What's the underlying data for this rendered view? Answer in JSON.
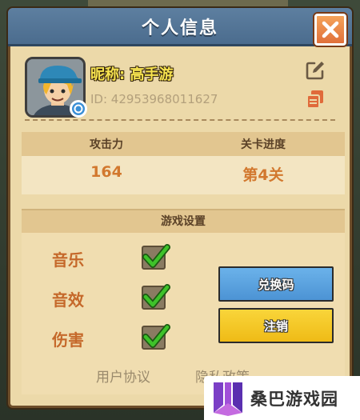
{
  "dialog": {
    "title": "个人信息",
    "close_icon": "close-icon"
  },
  "profile": {
    "nickname": "昵称: 高手游",
    "player_id": "ID: 42953968011627",
    "avatar": "avatar",
    "edit_icon": "edit-icon",
    "copy_icon": "copy-icon"
  },
  "stats": {
    "attack_label": "攻击力",
    "attack_value": "164",
    "progress_label": "关卡进度",
    "progress_value": "第4关"
  },
  "settings": {
    "header": "游戏设置",
    "items": [
      {
        "label": "音乐",
        "checked": true
      },
      {
        "label": "音效",
        "checked": true
      },
      {
        "label": "伤害",
        "checked": true
      }
    ],
    "redeem_label": "兑换码",
    "logout_label": "注销"
  },
  "footer": {
    "user_agreement": "用户协议",
    "privacy_policy": "隐私政策"
  },
  "watermark": {
    "text": "桑巴游戏园"
  },
  "colors": {
    "title_bar": "#5177a0",
    "close_button": "#e8783a",
    "panel": "#ecd9a9",
    "stat_value": "#d2782e",
    "setting_label": "#c5682a",
    "redeem_button": "#5aa3e0",
    "logout_button": "#f2c420",
    "checkmark": "#3ec22a"
  }
}
